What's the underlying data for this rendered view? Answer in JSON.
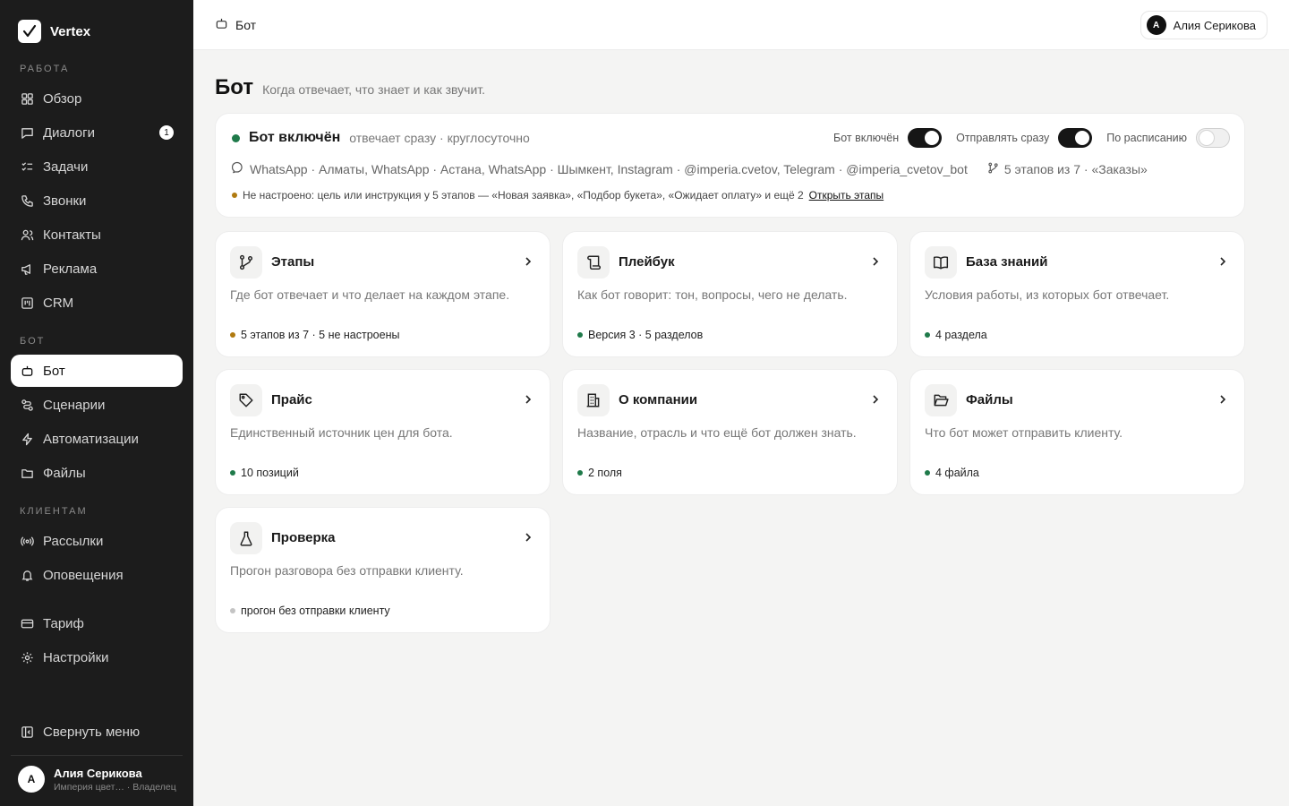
{
  "brand": {
    "name": "Vertex"
  },
  "sidebar": {
    "sections": {
      "work": "РАБОТА",
      "bot": "БОТ",
      "clients": "КЛИЕНТАМ"
    },
    "items": [
      {
        "label": "Обзор",
        "icon": "grid-icon"
      },
      {
        "label": "Диалоги",
        "icon": "chat-icon",
        "badge": "1"
      },
      {
        "label": "Задачи",
        "icon": "tasks-icon"
      },
      {
        "label": "Звонки",
        "icon": "phone-icon"
      },
      {
        "label": "Контакты",
        "icon": "users-icon"
      },
      {
        "label": "Реклама",
        "icon": "megaphone-icon"
      },
      {
        "label": "CRM",
        "icon": "kanban-icon"
      },
      {
        "label": "Бот",
        "icon": "bot-icon",
        "active": true
      },
      {
        "label": "Сценарии",
        "icon": "route-icon"
      },
      {
        "label": "Автоматизации",
        "icon": "bolt-icon"
      },
      {
        "label": "Файлы",
        "icon": "folder-icon"
      },
      {
        "label": "Рассылки",
        "icon": "broadcast-icon"
      },
      {
        "label": "Оповещения",
        "icon": "bell-icon"
      },
      {
        "label": "Тариф",
        "icon": "card-icon"
      },
      {
        "label": "Настройки",
        "icon": "gear-icon"
      }
    ],
    "collapse_label": "Свернуть меню",
    "user": {
      "initial": "А",
      "name": "Алия Серикова",
      "company": "Империя цвет…",
      "role": "· Владелец"
    }
  },
  "topbar": {
    "title": "Бот",
    "user_initial": "А",
    "user_name": "Алия Серикова"
  },
  "page": {
    "title": "Бот",
    "subtitle": "Когда отвечает, что знает и как звучит."
  },
  "status": {
    "title": "Бот включён",
    "description": "отвечает сразу · круглосуточно",
    "toggles": [
      {
        "label": "Бот включён",
        "on": true
      },
      {
        "label": "Отправлять сразу",
        "on": true
      },
      {
        "label": "По расписанию",
        "on": false
      }
    ],
    "channels": "WhatsApp · Алматы, WhatsApp · Астана, WhatsApp · Шымкент, Instagram · @imperia.cvetov, Telegram · @imperia_cvetov_bot",
    "stages": "5 этапов из 7 · «Заказы»",
    "warning": "Не настроено: цель или инструкция у 5 этапов — «Новая заявка», «Подбор букета», «Ожидает оплату» и ещё 2",
    "warning_link": "Открыть этапы",
    "colors": {
      "active": "#1f7a4a",
      "warning": "#b07a10"
    }
  },
  "cards": [
    {
      "title": "Этапы",
      "icon": "branch-icon",
      "desc": "Где бот отвечает и что делает на каждом этапе.",
      "meta": "5 этапов из 7 · 5 не настроены",
      "status": "warning"
    },
    {
      "title": "Плейбук",
      "icon": "scroll-icon",
      "desc": "Как бот говорит: тон, вопросы, чего не делать.",
      "meta": "Версия 3 · 5 разделов",
      "status": "ok"
    },
    {
      "title": "База знаний",
      "icon": "book-icon",
      "desc": "Условия работы, из которых бот отвечает.",
      "meta": "4 раздела",
      "status": "ok"
    },
    {
      "title": "Прайс",
      "icon": "tag-icon",
      "desc": "Единственный источник цен для бота.",
      "meta": "10 позиций",
      "status": "ok"
    },
    {
      "title": "О компании",
      "icon": "building-icon",
      "desc": "Название, отрасль и что ещё бот должен знать.",
      "meta": "2 поля",
      "status": "ok"
    },
    {
      "title": "Файлы",
      "icon": "folder-open-icon",
      "desc": "Что бот может отправить клиенту.",
      "meta": "4 файла",
      "status": "ok"
    },
    {
      "title": "Проверка",
      "icon": "flask-icon",
      "desc": "Прогон разговора без отправки клиенту.",
      "meta": "прогон без отправки клиенту",
      "status": "neutral"
    }
  ]
}
